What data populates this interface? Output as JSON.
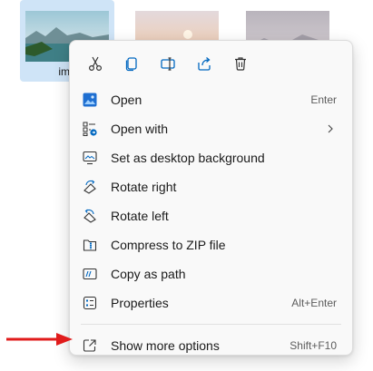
{
  "files": [
    {
      "name": "img",
      "selected": true,
      "thumb": "landscape-lake"
    },
    {
      "name": "",
      "selected": false,
      "thumb": "sunset-sky"
    },
    {
      "name": "",
      "selected": false,
      "thumb": "mountain-haze"
    }
  ],
  "quick_actions": [
    {
      "icon": "cut-icon"
    },
    {
      "icon": "copy-icon"
    },
    {
      "icon": "rename-icon"
    },
    {
      "icon": "share-icon"
    },
    {
      "icon": "delete-icon"
    }
  ],
  "menu": {
    "items": [
      {
        "label": "Open",
        "shortcut": "Enter",
        "icon": "photos-app-icon"
      },
      {
        "label": "Open with",
        "shortcut": "",
        "icon": "open-with-icon",
        "submenu": true
      },
      {
        "label": "Set as desktop background",
        "shortcut": "",
        "icon": "desktop-background-icon"
      },
      {
        "label": "Rotate right",
        "shortcut": "",
        "icon": "rotate-right-icon"
      },
      {
        "label": "Rotate left",
        "shortcut": "",
        "icon": "rotate-left-icon"
      },
      {
        "label": "Compress to ZIP file",
        "shortcut": "",
        "icon": "zip-icon"
      },
      {
        "label": "Copy as path",
        "shortcut": "",
        "icon": "copy-path-icon"
      },
      {
        "label": "Properties",
        "shortcut": "Alt+Enter",
        "icon": "properties-icon"
      }
    ],
    "footer_item": {
      "label": "Show more options",
      "shortcut": "Shift+F10",
      "icon": "show-more-icon"
    }
  },
  "colors": {
    "accent": "#0067c0",
    "selection": "#cfe4f7",
    "annotation_arrow": "#e01b1b"
  }
}
